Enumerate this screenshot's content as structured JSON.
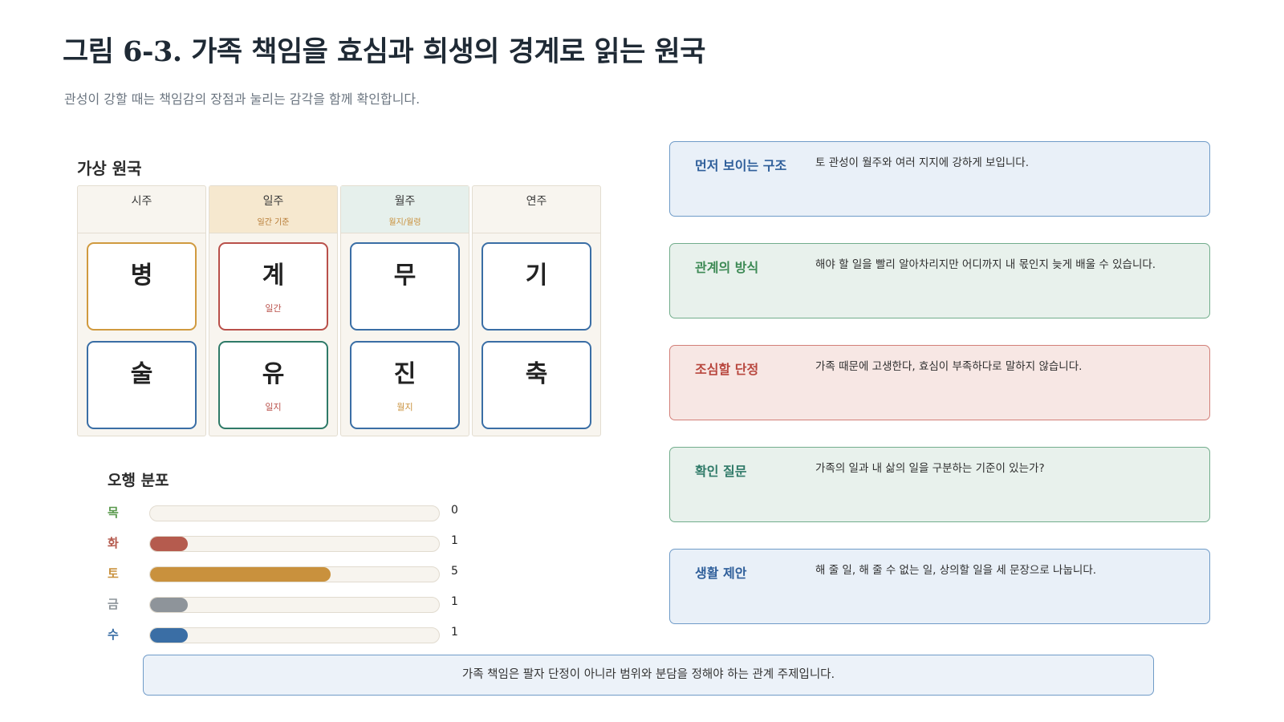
{
  "title": "그림 6-3. 가족 책임을 효심과 희생의 경계로 읽는 원국",
  "subtitle": "관성이 강할 때는 책임감의 장점과 눌리는 감각을 함께 확인합니다.",
  "chart": {
    "label": "가상 원국",
    "pillars": [
      {
        "name": "시주",
        "sub": "",
        "stem": {
          "char": "병",
          "tag": "",
          "color": "#d09a3f"
        },
        "branch": {
          "char": "술",
          "tag": "",
          "color": "#3a6ea5"
        }
      },
      {
        "name": "일주",
        "sub": "일간 기준",
        "stem": {
          "char": "계",
          "tag": "일간",
          "color": "#b9504a"
        },
        "branch": {
          "char": "유",
          "tag": "일지",
          "color": "#2f7a68"
        }
      },
      {
        "name": "월주",
        "sub": "월지/월령",
        "stem": {
          "char": "무",
          "tag": "",
          "color": "#3a6ea5"
        },
        "branch": {
          "char": "진",
          "tag": "월지",
          "color": "#3a6ea5"
        }
      },
      {
        "name": "연주",
        "sub": "",
        "stem": {
          "char": "기",
          "tag": "",
          "color": "#3a6ea5"
        },
        "branch": {
          "char": "축",
          "tag": "",
          "color": "#3a6ea5"
        }
      }
    ]
  },
  "distribution": {
    "label": "오행 분포",
    "max": 8,
    "items": [
      {
        "element": "목",
        "count": 0,
        "color": "#5a9a4e",
        "count_text": "0"
      },
      {
        "element": "화",
        "count": 1,
        "color": "#b55b4e",
        "count_text": "1"
      },
      {
        "element": "토",
        "count": 5,
        "color": "#c9913d",
        "count_text": "5"
      },
      {
        "element": "금",
        "count": 1,
        "color": "#8e949a",
        "count_text": "1"
      },
      {
        "element": "수",
        "count": 1,
        "color": "#3a6ea5",
        "count_text": "1"
      }
    ]
  },
  "panels": [
    {
      "title": "먼저 보이는 구조",
      "text": "토 관성이 월주와 여러 지지에 강하게 보입니다.",
      "style": "blue",
      "title_color": "#2e5e9a"
    },
    {
      "title": "관계의 방식",
      "text": "해야 할 일을 빨리 알아차리지만 어디까지 내 몫인지 늦게 배울 수 있습니다.",
      "style": "green",
      "title_color": "#3d8a55"
    },
    {
      "title": "조심할 단정",
      "text": "가족 때문에 고생한다, 효심이 부족하다로 말하지 않습니다.",
      "style": "red",
      "title_color": "#b8463d"
    },
    {
      "title": "확인 질문",
      "text": "가족의 일과 내 삶의 일을 구분하는 기준이 있는가?",
      "style": "green",
      "title_color": "#2f7a68"
    },
    {
      "title": "생활 제안",
      "text": "해 줄 일, 해 줄 수 없는 일, 상의할 일을 세 문장으로 나눕니다.",
      "style": "blue",
      "title_color": "#2e5e9a"
    }
  ],
  "footer": "가족 책임은 팔자 단정이 아니라 범위와 분담을 정해야 하는 관계 주제입니다."
}
